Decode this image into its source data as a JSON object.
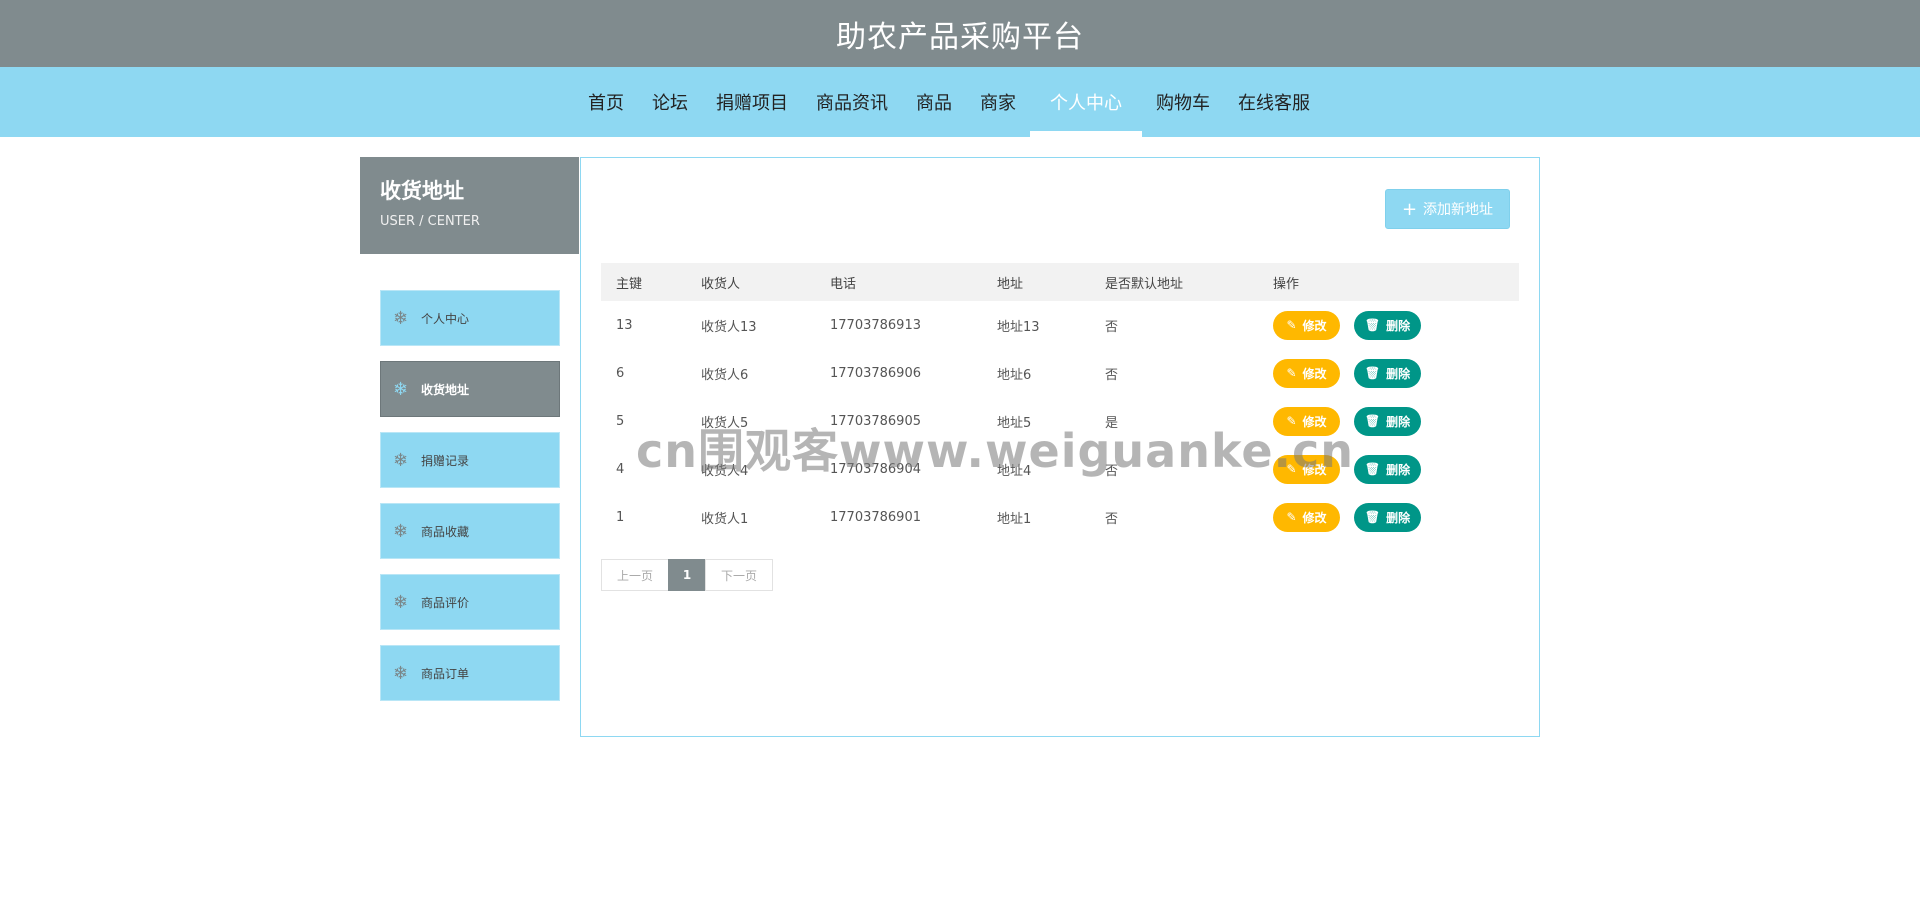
{
  "header": {
    "title": "助农产品采购平台"
  },
  "nav": {
    "items": [
      {
        "label": "首页"
      },
      {
        "label": "论坛"
      },
      {
        "label": "捐赠项目"
      },
      {
        "label": "商品资讯"
      },
      {
        "label": "商品"
      },
      {
        "label": "商家"
      },
      {
        "label": "个人中心"
      },
      {
        "label": "购物车"
      },
      {
        "label": "在线客服"
      }
    ],
    "active_index": 6
  },
  "sidebar": {
    "title": "收货地址",
    "subtitle": "USER / CENTER",
    "items": [
      {
        "label": "个人中心"
      },
      {
        "label": "收货地址"
      },
      {
        "label": "捐赠记录"
      },
      {
        "label": "商品收藏"
      },
      {
        "label": "商品评价"
      },
      {
        "label": "商品订单"
      }
    ],
    "active_index": 1,
    "icon": "snowflake-icon"
  },
  "main": {
    "add_button": "添加新地址",
    "table": {
      "headers": [
        "主键",
        "收货人",
        "电话",
        "地址",
        "是否默认地址",
        "操作"
      ],
      "rows": [
        {
          "id": "13",
          "name": "收货人13",
          "phone": "17703786913",
          "address": "地址13",
          "default": "否"
        },
        {
          "id": "6",
          "name": "收货人6",
          "phone": "17703786906",
          "address": "地址6",
          "default": "否"
        },
        {
          "id": "5",
          "name": "收货人5",
          "phone": "17703786905",
          "address": "地址5",
          "default": "是"
        },
        {
          "id": "4",
          "name": "收货人4",
          "phone": "17703786904",
          "address": "地址4",
          "default": "否"
        },
        {
          "id": "1",
          "name": "收货人1",
          "phone": "17703786901",
          "address": "地址1",
          "default": "否"
        }
      ],
      "edit_label": "修改",
      "delete_label": "删除"
    },
    "pagination": {
      "prev": "上一页",
      "current": "1",
      "next": "下一页"
    }
  },
  "watermark": "cn围观客www.weiguanke.cn",
  "colors": {
    "header_gray": "#808b8e",
    "nav_blue": "#8ed8f2",
    "edit_yellow": "#ffb800",
    "delete_teal": "#009688"
  }
}
